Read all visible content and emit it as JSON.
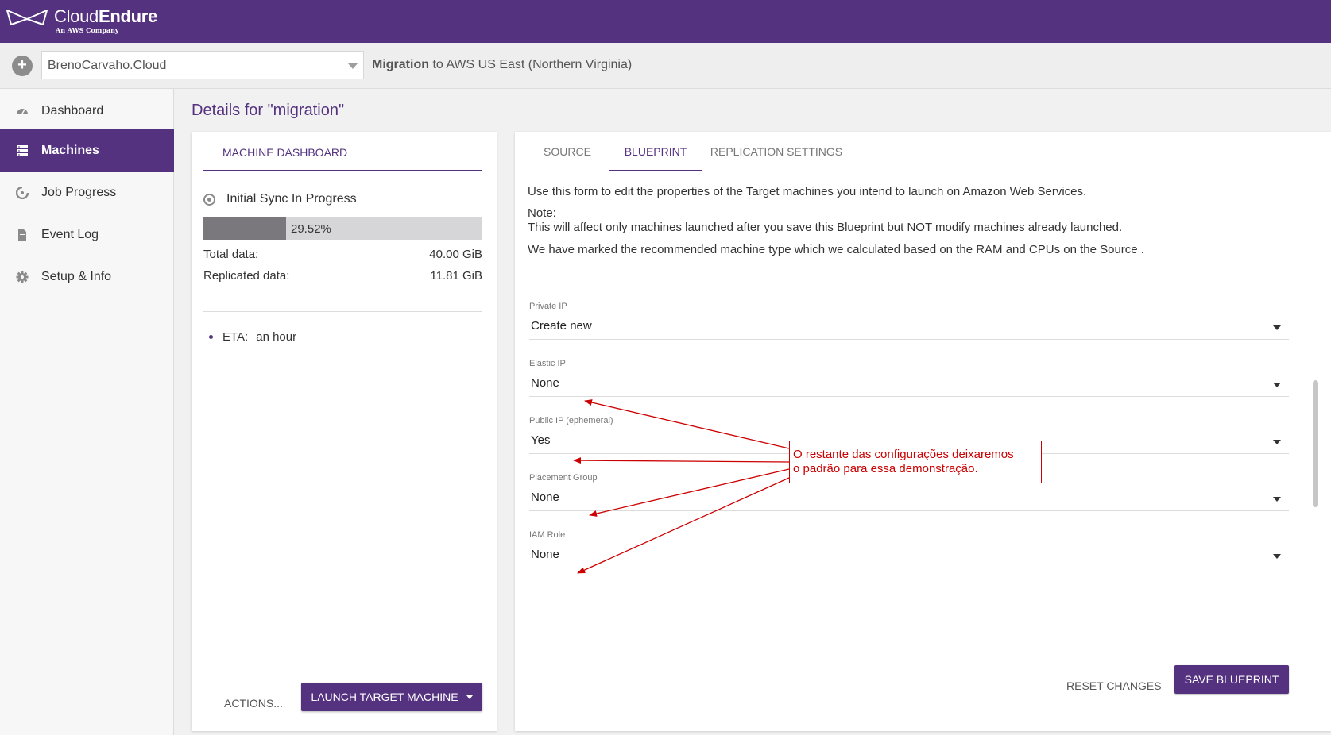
{
  "app": {
    "brand_light": "Cloud",
    "brand_bold": "Endure",
    "brand_sub": "An AWS Company",
    "accent_color": "#553280"
  },
  "project": {
    "add_icon": "plus-circle-icon",
    "selected": "BrenoCarvaho.Cloud",
    "migration_bold": "Migration",
    "migration_rest": " to AWS US East (Northern Virginia)"
  },
  "sidebar": {
    "items": [
      {
        "label": "Dashboard",
        "icon": "gauge-icon"
      },
      {
        "label": "Machines",
        "icon": "server-icon",
        "active": true
      },
      {
        "label": "Job Progress",
        "icon": "progress-icon"
      },
      {
        "label": "Event Log",
        "icon": "document-icon"
      },
      {
        "label": "Setup & Info",
        "icon": "gear-icon"
      }
    ]
  },
  "page": {
    "title": "Details for \"migration\""
  },
  "machine_panel": {
    "tab": "MACHINE DASHBOARD",
    "sync_status": "Initial Sync In Progress",
    "progress_label": "29.52%",
    "progress_fraction": 0.2952,
    "total_label": "Total data:",
    "total_value": "40.00 GiB",
    "replicated_label": "Replicated data:",
    "replicated_value": "11.81 GiB",
    "eta_label": "ETA:",
    "eta_value": "an hour",
    "actions": "ACTIONS...",
    "launch": "LAUNCH TARGET MACHINE"
  },
  "blueprint": {
    "tabs": [
      "SOURCE",
      "BLUEPRINT",
      "REPLICATION SETTINGS"
    ],
    "active_tab": "BLUEPRINT",
    "intro": "Use this form to edit the properties of the Target machines you intend to launch on Amazon Web Services.",
    "note_title": "Note:",
    "note_text": "This will affect only machines launched after you save this Blueprint but NOT modify machines already launched.",
    "recommend": "We have marked the recommended machine type which we calculated based on the RAM and CPUs on the Source .",
    "fields": [
      {
        "label": "Private IP",
        "value": "Create new"
      },
      {
        "label": "Elastic IP",
        "value": "None"
      },
      {
        "label": "Public IP (ephemeral)",
        "value": "Yes"
      },
      {
        "label": "Placement Group",
        "value": "None"
      },
      {
        "label": "IAM Role",
        "value": "None"
      }
    ],
    "reset": "RESET CHANGES",
    "save": "SAVE BLUEPRINT"
  },
  "annotation": {
    "line1": "O restante das configurações deixaremos",
    "line2": "o padrão para essa demonstração.",
    "color": "#cc0000"
  }
}
